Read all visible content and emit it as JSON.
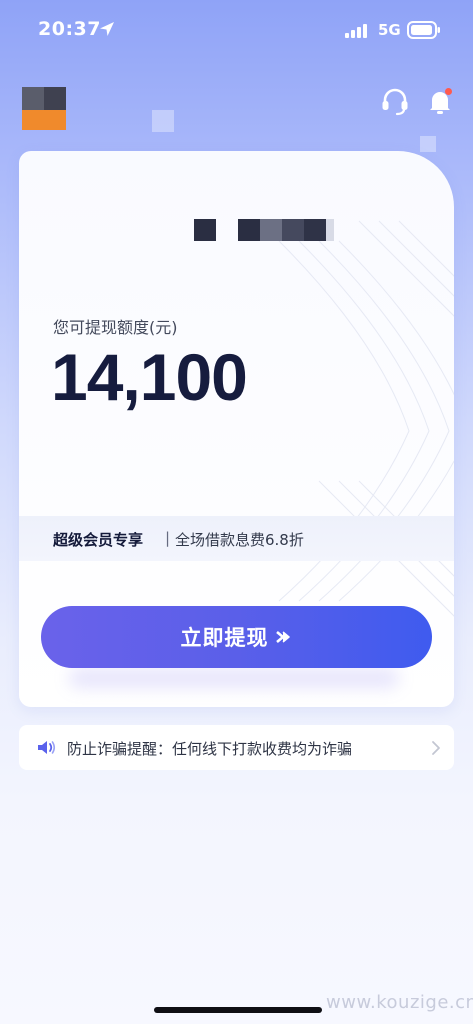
{
  "status_bar": {
    "time": "20:37",
    "network": "5G",
    "icons": [
      "location-arrow-icon",
      "signal-icon",
      "battery-icon"
    ]
  },
  "header": {
    "icons": [
      "headset-icon",
      "bell-icon"
    ],
    "notification_dot_color": "#ff5a4e"
  },
  "card": {
    "credit_label": "您可提现额度(元)",
    "credit_amount": "14,100",
    "promo": {
      "title": "超级会员专享",
      "separator": "|",
      "description": "全场借款息费6.8折"
    },
    "withdraw_button": {
      "label": "立即提现",
      "icon": "double-chevron-right-icon"
    }
  },
  "notice": {
    "icon": "speaker-icon",
    "text": "防止诈骗提醒：任何线下打款收费均为诈骗",
    "chevron": "chevron-right-icon"
  },
  "watermark": "www.kouzige.cn",
  "colors": {
    "primary": "#5a5fe9",
    "amount_text": "#161c3e",
    "logo_orange": "#f08a2c"
  }
}
